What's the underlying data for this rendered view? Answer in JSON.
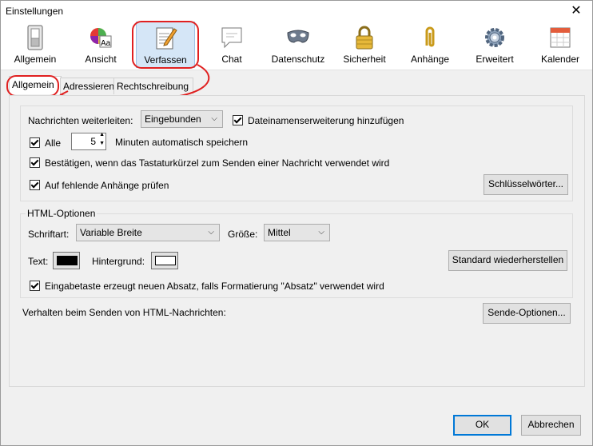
{
  "window": {
    "title": "Einstellungen",
    "close_glyph": "✕"
  },
  "toolbar": [
    {
      "label": "Allgemein",
      "icon": "switch-icon"
    },
    {
      "label": "Ansicht",
      "icon": "palette-icon"
    },
    {
      "label": "Verfassen",
      "icon": "compose-icon",
      "selected": true
    },
    {
      "label": "Chat",
      "icon": "chat-bubble-icon"
    },
    {
      "label": "Datenschutz",
      "icon": "mask-icon"
    },
    {
      "label": "Sicherheit",
      "icon": "padlock-icon"
    },
    {
      "label": "Anhänge",
      "icon": "paperclip-icon"
    },
    {
      "label": "Erweitert",
      "icon": "gear-icon"
    },
    {
      "label": "Kalender",
      "icon": "calendar-icon"
    }
  ],
  "tabs": [
    {
      "label": "Allgemein",
      "selected": true
    },
    {
      "label": "Adressieren"
    },
    {
      "label": "Rechtschreibung"
    }
  ],
  "general": {
    "forward_label": "Nachrichten weiterleiten:",
    "forward_value": "Eingebunden",
    "add_extension_label": "Dateinamenserweiterung hinzufügen",
    "add_extension_checked": true,
    "autosave_label": "Alle",
    "autosave_checked": true,
    "autosave_value": "5",
    "autosave_suffix": "Minuten automatisch speichern",
    "confirm_label": "Bestätigen, wenn das Tastaturkürzel zum Senden einer Nachricht verwendet wird",
    "confirm_checked": true,
    "attachments_label": "Auf fehlende Anhänge prüfen",
    "attachments_checked": true,
    "keywords_button": "Schlüsselwörter..."
  },
  "html_options": {
    "legend": "HTML-Optionen",
    "font_label": "Schriftart:",
    "font_value": "Variable Breite",
    "size_label": "Größe:",
    "size_value": "Mittel",
    "text_label": "Text:",
    "text_color": "#000000",
    "background_label": "Hintergrund:",
    "background_color": "#ffffff",
    "restore_button": "Standard wiederherstellen",
    "enter_label": "Eingabetaste erzeugt neuen Absatz, falls Formatierung \"Absatz\" verwendet wird",
    "enter_checked": true
  },
  "send": {
    "label": "Verhalten beim Senden von HTML-Nachrichten:",
    "button": "Sende-Optionen..."
  },
  "footer": {
    "ok": "OK",
    "cancel": "Abbrechen"
  },
  "annotation_color": "#e02020"
}
